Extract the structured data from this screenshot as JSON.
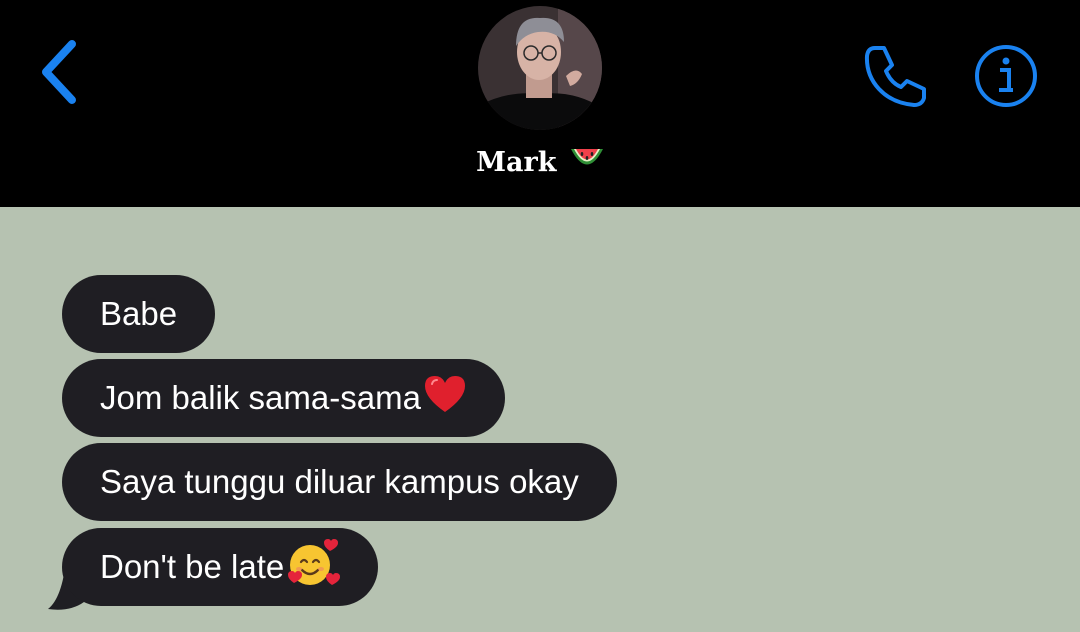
{
  "header": {
    "contact_name": "Mark",
    "icons": {
      "back": "chevron-left-icon",
      "phone": "phone-icon",
      "info": "info-icon",
      "name_emoji": "watermelon-emoji"
    }
  },
  "messages": [
    {
      "text": "Babe",
      "emoji": ""
    },
    {
      "text": "Jom balik sama-sama",
      "emoji": "red-heart-emoji"
    },
    {
      "text": "Saya tunggu diluar kampus okay",
      "emoji": ""
    },
    {
      "text": "Don't be late",
      "emoji": "smiling-face-with-hearts-emoji"
    }
  ],
  "colors": {
    "accent": "#1a82f0",
    "header_bg": "#000000",
    "chat_bg": "#b6c2b1",
    "bubble_bg": "#1f1e23",
    "bubble_text": "#ffffff"
  }
}
